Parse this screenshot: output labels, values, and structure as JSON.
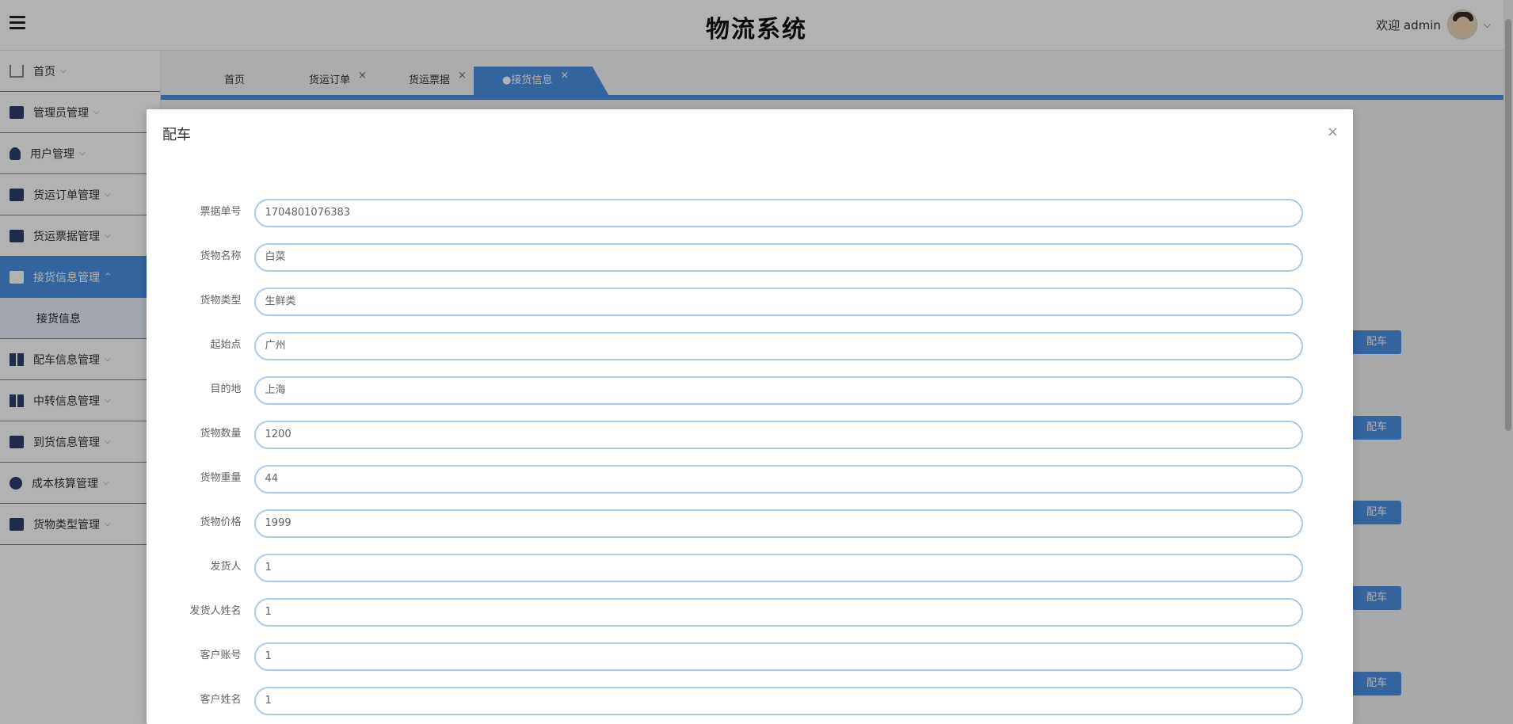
{
  "header": {
    "title": "物流系统",
    "welcome": "欢迎 admin"
  },
  "sidebar": {
    "items": [
      {
        "label": "首页",
        "icon": "home-icon"
      },
      {
        "label": "管理员管理",
        "icon": "mail-icon"
      },
      {
        "label": "用户管理",
        "icon": "user-icon"
      },
      {
        "label": "货运订单管理",
        "icon": "box-icon"
      },
      {
        "label": "货运票据管理",
        "icon": "printer-icon"
      },
      {
        "label": "接货信息管理",
        "icon": "truck-icon",
        "active": true
      },
      {
        "label": "配车信息管理",
        "icon": "columns-icon"
      },
      {
        "label": "中转信息管理",
        "icon": "grid-icon"
      },
      {
        "label": "到货信息管理",
        "icon": "card-icon"
      },
      {
        "label": "成本核算管理",
        "icon": "more-icon"
      },
      {
        "label": "货物类型管理",
        "icon": "briefcase-icon"
      }
    ],
    "sub_item": "接货信息"
  },
  "tabs": [
    {
      "label": "首页"
    },
    {
      "label": "货运订单"
    },
    {
      "label": "货运票据"
    },
    {
      "label": "●接货信息"
    }
  ],
  "table": {
    "action_label": "配车"
  },
  "modal": {
    "title": "配车",
    "close": "×",
    "fields": [
      {
        "label": "票据单号",
        "value": "1704801076383"
      },
      {
        "label": "货物名称",
        "value": "白菜"
      },
      {
        "label": "货物类型",
        "value": "生鲜类"
      },
      {
        "label": "起始点",
        "value": "广州"
      },
      {
        "label": "目的地",
        "value": "上海"
      },
      {
        "label": "货物数量",
        "value": "1200"
      },
      {
        "label": "货物重量",
        "value": "44"
      },
      {
        "label": "货物价格",
        "value": "1999"
      },
      {
        "label": "发货人",
        "value": "1"
      },
      {
        "label": "发货人姓名",
        "value": "1"
      },
      {
        "label": "客户账号",
        "value": "1"
      },
      {
        "label": "客户姓名",
        "value": "1"
      }
    ]
  },
  "colors": {
    "accent": "#4a90e2"
  }
}
